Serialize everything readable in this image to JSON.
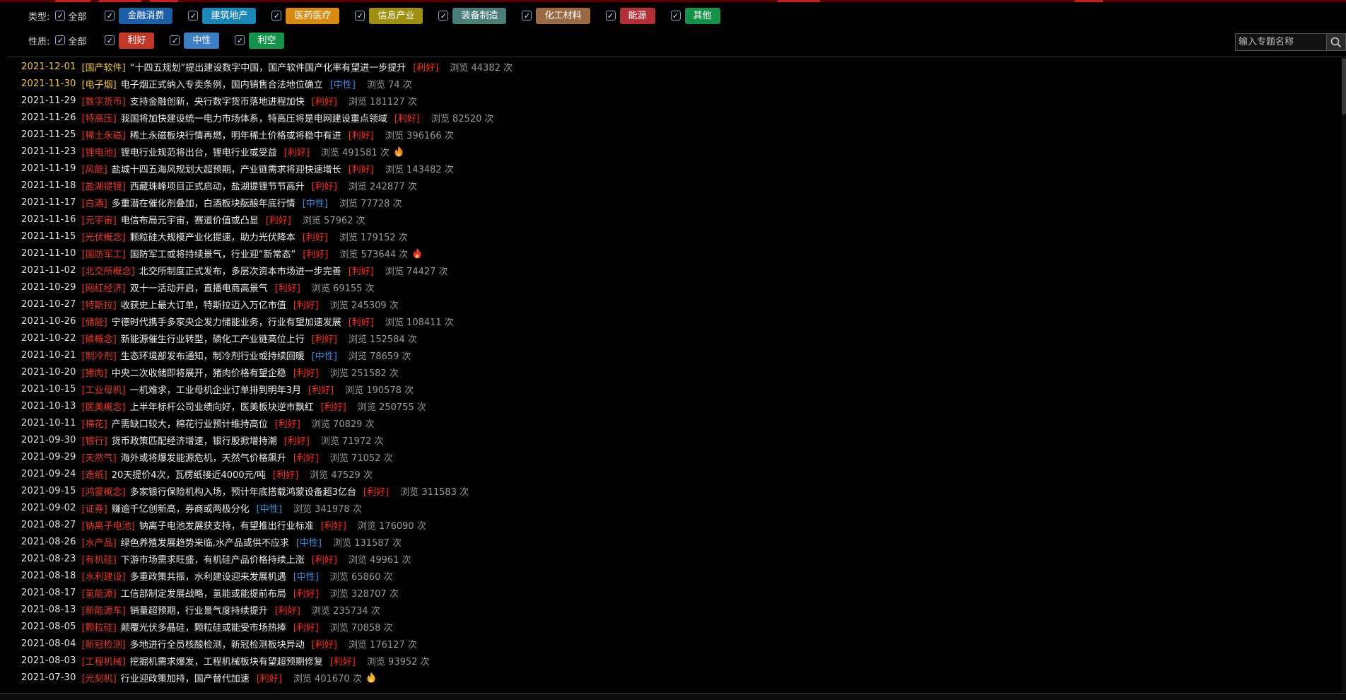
{
  "filters": {
    "type": {
      "label": "类型:",
      "all_label": "全部",
      "chips": [
        {
          "label": "金融消费",
          "color": "#1c5fa8"
        },
        {
          "label": "建筑地产",
          "color": "#1b86b8"
        },
        {
          "label": "医药医疗",
          "color": "#d88a12"
        },
        {
          "label": "信息产业",
          "color": "#a08f12"
        },
        {
          "label": "装备制造",
          "color": "#4b7e78"
        },
        {
          "label": "化工材料",
          "color": "#9b6a45"
        },
        {
          "label": "能源",
          "color": "#b42f36"
        },
        {
          "label": "其他",
          "color": "#18924a"
        }
      ]
    },
    "nature": {
      "label": "性质:",
      "all_label": "全部",
      "chips": [
        {
          "label": "利好",
          "color": "#c0392b"
        },
        {
          "label": "中性",
          "color": "#3d7fc2"
        },
        {
          "label": "利空",
          "color": "#16924a"
        }
      ]
    }
  },
  "search": {
    "placeholder": "输入专题名称",
    "value": ""
  },
  "labels": {
    "views_prefix": "浏览",
    "views_suffix": "次"
  },
  "items": [
    {
      "date": "2021-12-01",
      "category": "[国产软件]",
      "title": "“十四五规划”提出建设数字中国，国产软件国产化率有望进一步提升",
      "tag": "[利好]",
      "nature": "good",
      "views": "44382",
      "highlight": true
    },
    {
      "date": "2021-11-30",
      "category": "[电子烟]",
      "title": "电子烟正式纳入专卖条例，国内销售合法地位确立",
      "tag": "[中性]",
      "nature": "neutral",
      "views": "74",
      "highlight": true
    },
    {
      "date": "2021-11-29",
      "category": "[数字货币]",
      "title": "支持金融创新，央行数字货币落地进程加快",
      "tag": "[利好]",
      "nature": "good",
      "views": "181127"
    },
    {
      "date": "2021-11-26",
      "category": "[特高压]",
      "title": "我国将加快建设统一电力市场体系，特高压将是电网建设重点领域",
      "tag": "[利好]",
      "nature": "good",
      "views": "82520"
    },
    {
      "date": "2021-11-25",
      "category": "[稀土永磁]",
      "title": "稀土永磁板块行情再燃，明年稀土价格或将稳中有进",
      "tag": "[利好]",
      "nature": "good",
      "views": "396166"
    },
    {
      "date": "2021-11-23",
      "category": "[锂电池]",
      "title": "锂电行业规范将出台，锂电行业或受益",
      "tag": "[利好]",
      "nature": "good",
      "views": "491581",
      "icon": "fire-orange"
    },
    {
      "date": "2021-11-19",
      "category": "[风能]",
      "title": "盐城十四五海风规划大超预期，产业链需求将迎快速增长",
      "tag": "[利好]",
      "nature": "good",
      "views": "143482"
    },
    {
      "date": "2021-11-18",
      "category": "[盐湖提锂]",
      "title": "西藏珠峰项目正式启动，盐湖提锂节节高升",
      "tag": "[利好]",
      "nature": "good",
      "views": "242877"
    },
    {
      "date": "2021-11-17",
      "category": "[白酒]",
      "title": "多重潜在催化剂叠加，白酒板块酝酿年底行情",
      "tag": "[中性]",
      "nature": "neutral",
      "views": "77728"
    },
    {
      "date": "2021-11-16",
      "category": "[元宇宙]",
      "title": "电信布局元宇宙，赛道价值或凸显",
      "tag": "[利好]",
      "nature": "good",
      "views": "57962"
    },
    {
      "date": "2021-11-15",
      "category": "[光伏概念]",
      "title": "颗粒硅大规模产业化提速，助力光伏降本",
      "tag": "[利好]",
      "nature": "good",
      "views": "179152"
    },
    {
      "date": "2021-11-10",
      "category": "[国防军工]",
      "title": "国防军工或将持续景气，行业迎“新常态”",
      "tag": "[利好]",
      "nature": "good",
      "views": "573644",
      "icon": "fire-red"
    },
    {
      "date": "2021-11-02",
      "category": "[北交所概念]",
      "title": "北交所制度正式发布，多层次资本市场进一步完善",
      "tag": "[利好]",
      "nature": "good",
      "views": "74427"
    },
    {
      "date": "2021-10-29",
      "category": "[网红经济]",
      "title": "双十一活动开启，直播电商高景气",
      "tag": "[利好]",
      "nature": "good",
      "views": "69155"
    },
    {
      "date": "2021-10-27",
      "category": "[特斯拉]",
      "title": "收获史上最大订单，特斯拉迈入万亿市值",
      "tag": "[利好]",
      "nature": "good",
      "views": "245309"
    },
    {
      "date": "2021-10-26",
      "category": "[储能]",
      "title": "宁德时代携手多家央企发力储能业务，行业有望加速发展",
      "tag": "[利好]",
      "nature": "good",
      "views": "108411"
    },
    {
      "date": "2021-10-22",
      "category": "[磷概念]",
      "title": "新能源催生行业转型，磷化工产业链高位上行",
      "tag": "[利好]",
      "nature": "good",
      "views": "152584"
    },
    {
      "date": "2021-10-21",
      "category": "[制冷剂]",
      "title": "生态环境部发布通知，制冷剂行业或持续回暖",
      "tag": "[中性]",
      "nature": "neutral",
      "views": "78659"
    },
    {
      "date": "2021-10-20",
      "category": "[猪肉]",
      "title": "中央二次收储即将展开，猪肉价格有望企稳",
      "tag": "[利好]",
      "nature": "good",
      "views": "251582"
    },
    {
      "date": "2021-10-15",
      "category": "[工业母机]",
      "title": "一机难求，工业母机企业订单排到明年3月",
      "tag": "[利好]",
      "nature": "good",
      "views": "190578"
    },
    {
      "date": "2021-10-13",
      "category": "[医美概念]",
      "title": "上半年标杆公司业绩向好，医美板块逆市飘红",
      "tag": "[利好]",
      "nature": "good",
      "views": "250755"
    },
    {
      "date": "2021-10-11",
      "category": "[棉花]",
      "title": "产需缺口较大，棉花行业预计维持高位",
      "tag": "[利好]",
      "nature": "good",
      "views": "70829"
    },
    {
      "date": "2021-09-30",
      "category": "[银行]",
      "title": "货币政策匹配经济增速，银行股掀增持潮",
      "tag": "[利好]",
      "nature": "good",
      "views": "71972"
    },
    {
      "date": "2021-09-29",
      "category": "[天然气]",
      "title": "海外或将爆发能源危机，天然气价格飙升",
      "tag": "[利好]",
      "nature": "good",
      "views": "71052"
    },
    {
      "date": "2021-09-24",
      "category": "[造纸]",
      "title": "20天提价4次，瓦楞纸接近4000元/吨",
      "tag": "[利好]",
      "nature": "good",
      "views": "47529"
    },
    {
      "date": "2021-09-15",
      "category": "[鸿蒙概念]",
      "title": "多家银行保险机构入场，预计年底搭载鸿蒙设备超3亿台",
      "tag": "[利好]",
      "nature": "good",
      "views": "311583"
    },
    {
      "date": "2021-09-02",
      "category": "[证券]",
      "title": "赚逾千亿创新高，券商或两极分化",
      "tag": "[中性]",
      "nature": "neutral",
      "views": "341978"
    },
    {
      "date": "2021-08-27",
      "category": "[钠离子电池]",
      "title": "钠离子电池发展获支持，有望推出行业标准",
      "tag": "[利好]",
      "nature": "good",
      "views": "176090"
    },
    {
      "date": "2021-08-26",
      "category": "[水产品]",
      "title": "绿色养殖发展趋势来临,水产品或供不应求",
      "tag": "[中性]",
      "nature": "neutral",
      "views": "131587"
    },
    {
      "date": "2021-08-23",
      "category": "[有机硅]",
      "title": "下游市场需求旺盛，有机硅产品价格持续上涨",
      "tag": "[利好]",
      "nature": "good",
      "views": "49961"
    },
    {
      "date": "2021-08-18",
      "category": "[水利建设]",
      "title": "多重政策共振，水利建设迎来发展机遇",
      "tag": "[中性]",
      "nature": "neutral",
      "views": "65860"
    },
    {
      "date": "2021-08-17",
      "category": "[氢能源]",
      "title": "工信部制定发展战略，氢能或能提前布局",
      "tag": "[利好]",
      "nature": "good",
      "views": "328707"
    },
    {
      "date": "2021-08-13",
      "category": "[新能源车]",
      "title": "销量超预期，行业景气度持续提升",
      "tag": "[利好]",
      "nature": "good",
      "views": "235734"
    },
    {
      "date": "2021-08-05",
      "category": "[颗粒硅]",
      "title": "颠覆光伏多晶硅，颗粒硅或能受市场热捧",
      "tag": "[利好]",
      "nature": "good",
      "views": "70858"
    },
    {
      "date": "2021-08-04",
      "category": "[新冠检测]",
      "title": "多地进行全员核酸检测，新冠检测板块异动",
      "tag": "[利好]",
      "nature": "good",
      "views": "176127"
    },
    {
      "date": "2021-08-03",
      "category": "[工程机械]",
      "title": "挖掘机需求爆发，工程机械板块有望超预期修复",
      "tag": "[利好]",
      "nature": "good",
      "views": "93952"
    },
    {
      "date": "2021-07-30",
      "category": "[光刻机]",
      "title": "行业迎政策加持，国产替代加速",
      "tag": "[利好]",
      "nature": "good",
      "views": "401670",
      "icon": "fire-yellow"
    }
  ]
}
